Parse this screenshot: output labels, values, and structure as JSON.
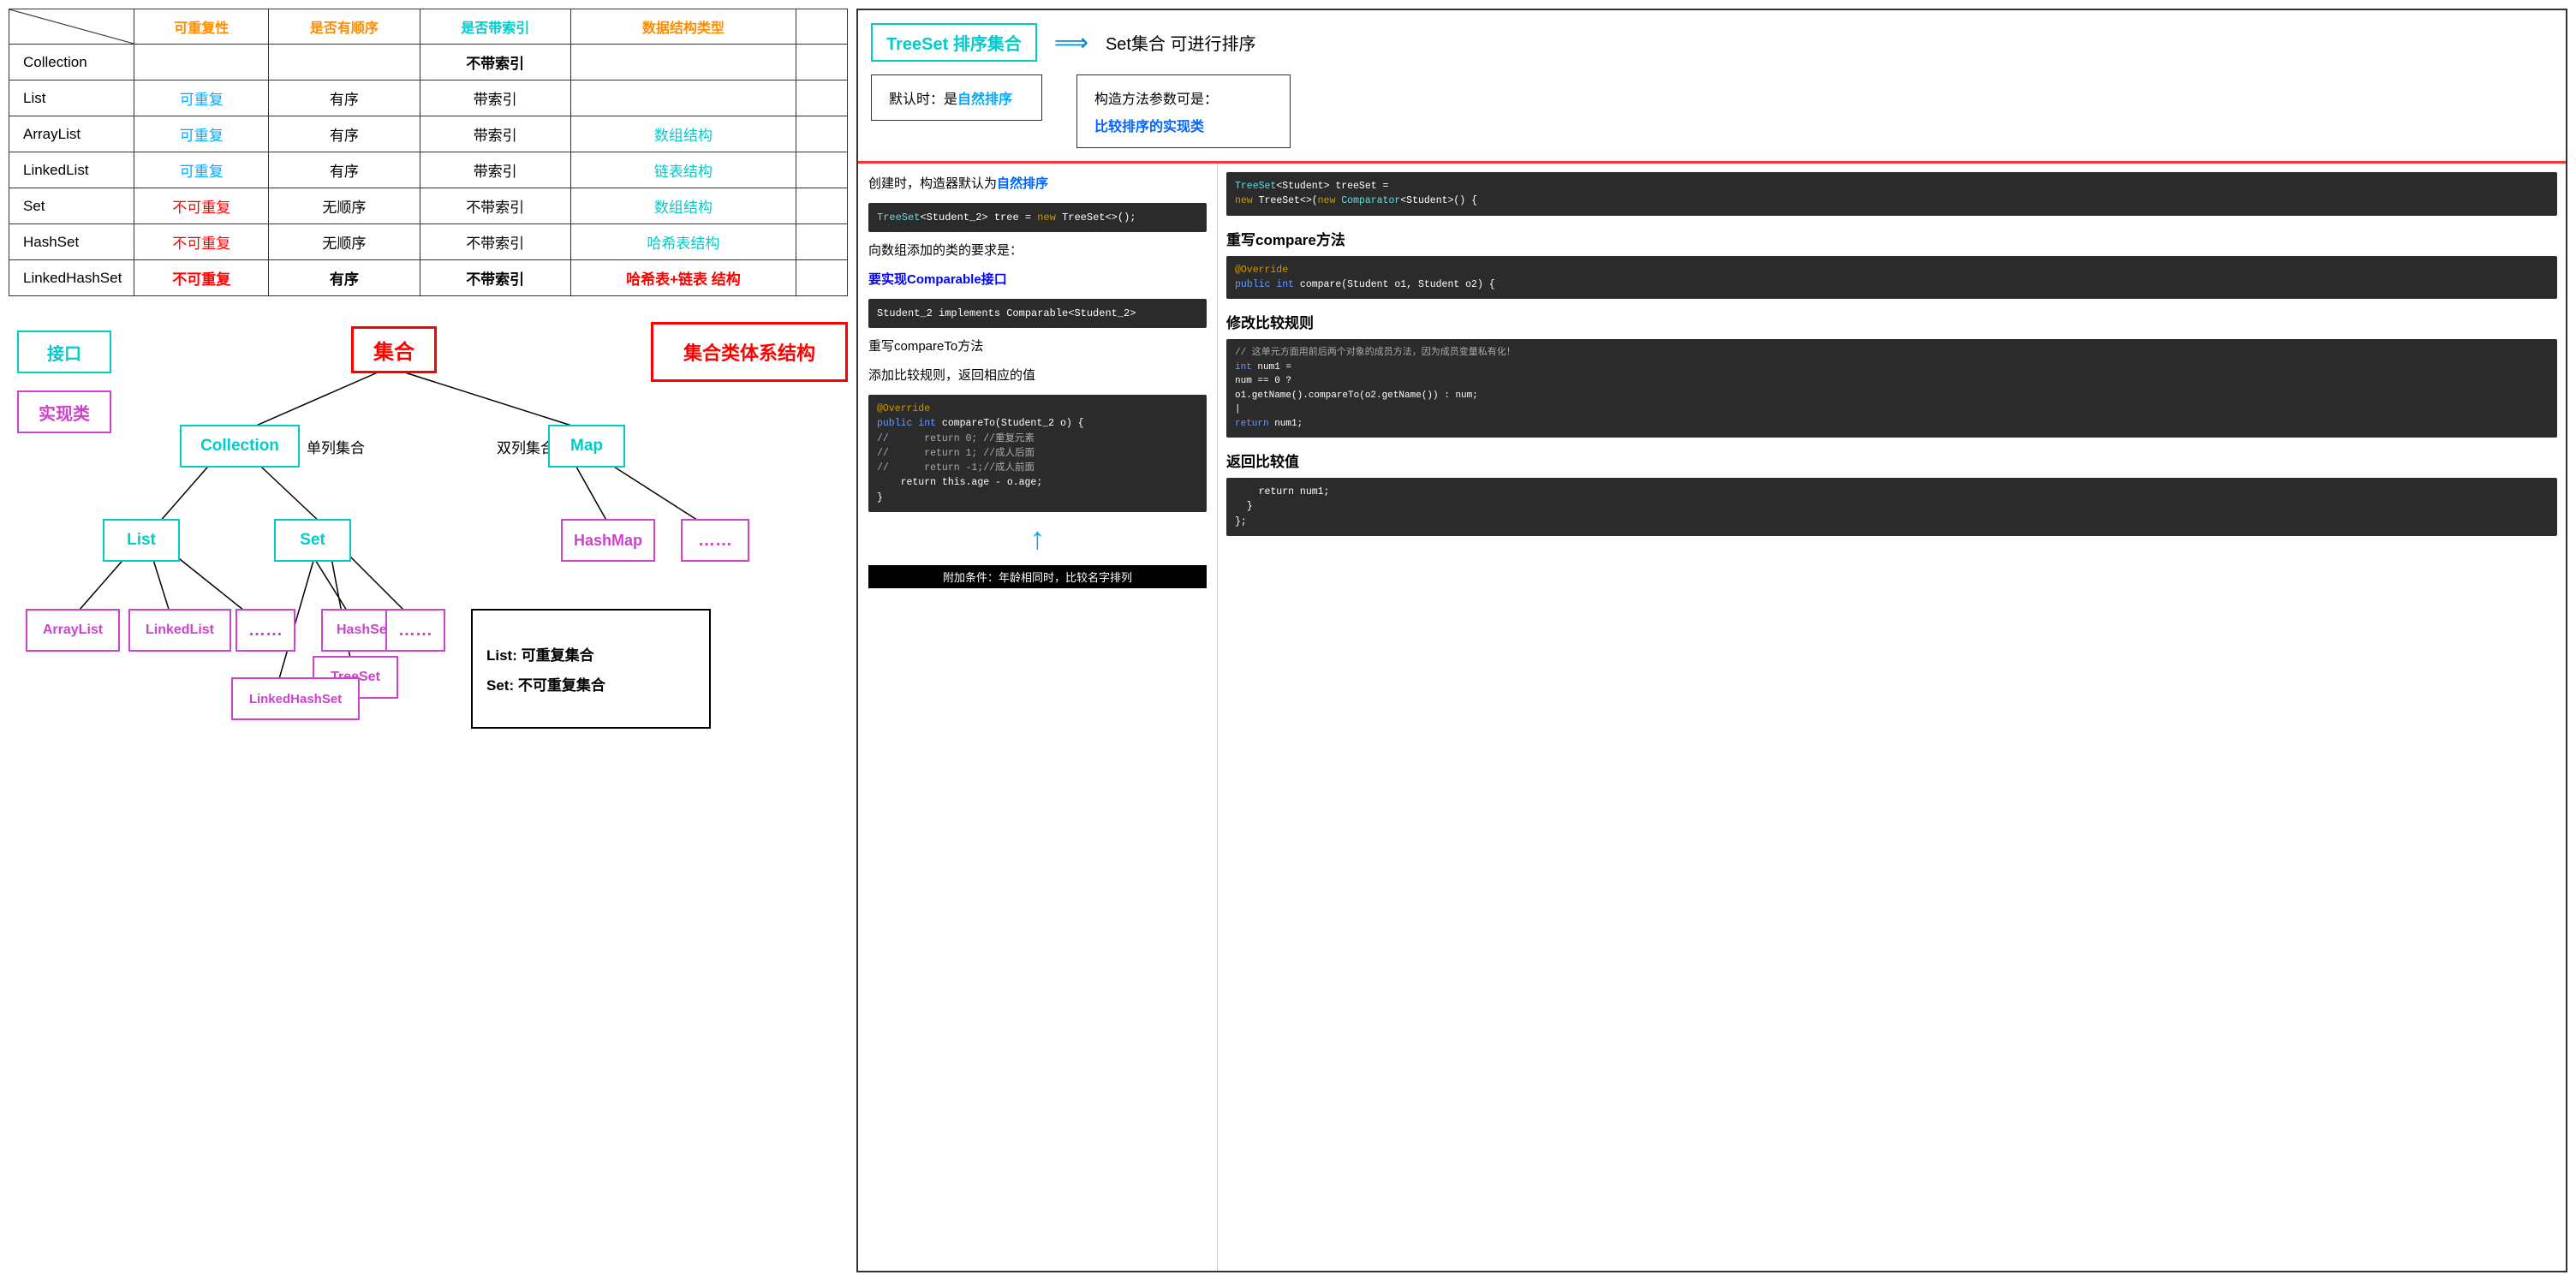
{
  "table": {
    "headers": [
      "",
      "可重复性",
      "是否有顺序",
      "是否带索引",
      "数据结构类型",
      ""
    ],
    "rows": [
      {
        "name": "Collection",
        "repeat": "",
        "order": "",
        "index": "不带索引",
        "structure": ""
      },
      {
        "name": "List",
        "repeat": "可重复",
        "order": "有序",
        "index": "带索引",
        "structure": ""
      },
      {
        "name": "ArrayList",
        "repeat": "可重复",
        "order": "有序",
        "index": "带索引",
        "structure": "数组结构"
      },
      {
        "name": "LinkedList",
        "repeat": "可重复",
        "order": "有序",
        "index": "带索引",
        "structure": "链表结构"
      },
      {
        "name": "Set",
        "repeat": "不可重复",
        "order": "无顺序",
        "index": "不带索引",
        "structure": "数组结构"
      },
      {
        "name": "HashSet",
        "repeat": "不可重复",
        "order": "无顺序",
        "index": "不带索引",
        "structure": "哈希表结构"
      },
      {
        "name": "LinkedHashSet",
        "repeat": "不可重复",
        "order": "有序",
        "index": "不带索引",
        "structure": "哈希表+链表 结构"
      }
    ]
  },
  "diagram": {
    "interface_label": "接口",
    "impl_label": "实现类",
    "collection_label": "集合",
    "collection_node": "Collection",
    "collection_sublabel": "单列集合",
    "dual_label": "双列集合",
    "list_node": "List",
    "set_node": "Set",
    "map_node": "Map",
    "arraylist_node": "ArrayList",
    "linkedlist_node": "LinkedList",
    "dots1": "……",
    "hashset_node": "HashSet",
    "treeset_node": "TreeSet",
    "dots2": "……",
    "linkedhashset_node": "LinkedHashSet",
    "hashmap_node": "HashMap",
    "dots3": "……",
    "title": "集合类体系结构",
    "desc_list": "List:  可重复集合",
    "desc_set": "Set:  不可重复集合"
  },
  "right": {
    "treeset_label": "TreeSet 排序集合",
    "arrow": "⟹",
    "set_desc": "Set集合   可进行排序",
    "default_sort": "默认时：是",
    "natural_sort": "自然排序",
    "construct_prefix": "构造方法参数可是：",
    "comparator_label": "比较排序的实现类",
    "create_desc1": "创建时，构造器默认为",
    "natural_sort2": "自然排序",
    "code1": "TreeSet<Student_2> tree = new TreeSet<>();",
    "add_req": "向数组添加的类的要求是：",
    "comparable_req": "要实现Comparable接口",
    "code2": "Student_2 implements Comparable<Student_2>",
    "override_label": "重写compareTo方法",
    "add_rule": "添加比较规则，返回相应的值",
    "code_compare": "@Override\npublic int compareTo(Student_2 o) {\n//      return 0; //重复元素\n//      return 1; //成人后面\n//      return -1;//成人前面\n    return this.age - o.age;\n}",
    "section_override": "重写compare方法",
    "code_override": "@Override\npublic int compare(Student o1, Student o2) {",
    "section_modify": "修改比较规则",
    "code_modify": "// 这单元方面用前后两个对象的成员方法，因为成员变量私有化！\nint num1 =\nnum == 0 ?\no1.getName().compareTo(o2.getName()) : num;\n|\nreturn num1;",
    "section_return": "返回比较值",
    "code_return": "    return num1;\n  }\n};",
    "bottom_label1": "附加条件：年龄相同时，比较名字排列"
  }
}
